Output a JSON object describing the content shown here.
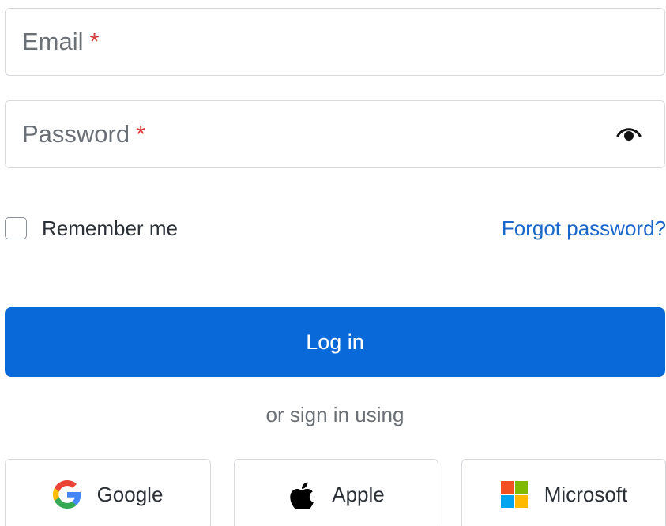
{
  "form": {
    "email": {
      "placeholder": "Email",
      "required_mark": "*"
    },
    "password": {
      "placeholder": "Password",
      "required_mark": "*",
      "toggle_icon": "eye-icon"
    },
    "remember_me": {
      "label": "Remember me",
      "checked": false
    },
    "forgot_password": "Forgot password?",
    "login_button": "Log in",
    "divider_text": "or sign in using"
  },
  "social_providers": [
    {
      "label": "Google",
      "icon": "google-icon"
    },
    {
      "label": "Apple",
      "icon": "apple-icon"
    },
    {
      "label": "Microsoft",
      "icon": "microsoft-icon"
    }
  ],
  "colors": {
    "primary": "#0a69d8",
    "link": "#1a66c9",
    "required": "#d93a3a",
    "border": "#d7d9dd"
  }
}
